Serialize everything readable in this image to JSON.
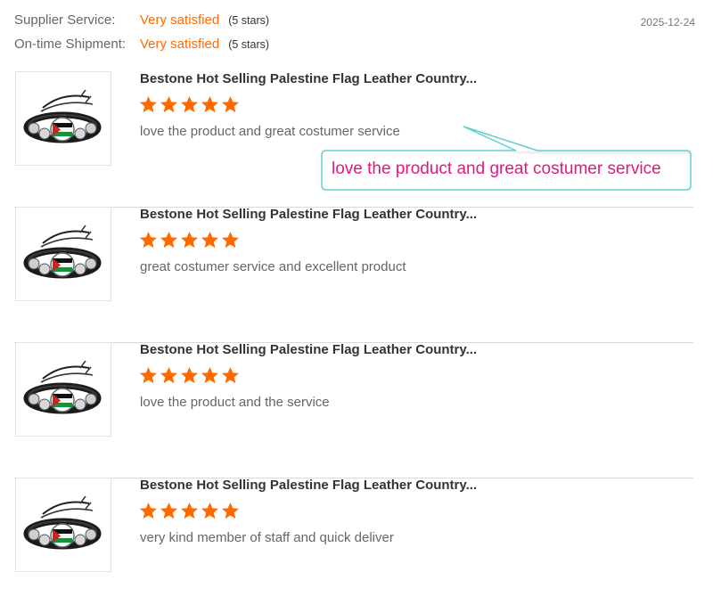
{
  "summary": {
    "rows": [
      {
        "label": "Supplier Service:",
        "value": "Very satisfied",
        "stars": "(5 stars)"
      },
      {
        "label": "On-time Shipment:",
        "value": "Very satisfied",
        "stars": "(5 stars)"
      }
    ],
    "date": "2025-12-24"
  },
  "reviews": [
    {
      "title": "Bestone Hot Selling Palestine Flag Leather Country...",
      "rating": 5,
      "comment": "love the product and great costumer service"
    },
    {
      "title": "Bestone Hot Selling Palestine Flag Leather Country...",
      "rating": 5,
      "comment": "great costumer service and excellent product"
    },
    {
      "title": "Bestone Hot Selling Palestine Flag Leather Country...",
      "rating": 5,
      "comment": "love the product and the service"
    },
    {
      "title": "Bestone Hot Selling Palestine Flag Leather Country...",
      "rating": 5,
      "comment": "very kind member of staff and quick deliver"
    }
  ],
  "callout": {
    "text": "love the product and great costumer service"
  },
  "colors": {
    "accent": "#ff6a00",
    "callout_text": "#e0197c",
    "callout_border": "#5fcfcf"
  },
  "icons": {
    "star": "star-icon",
    "thumbnail": "bracelet-product-image"
  }
}
